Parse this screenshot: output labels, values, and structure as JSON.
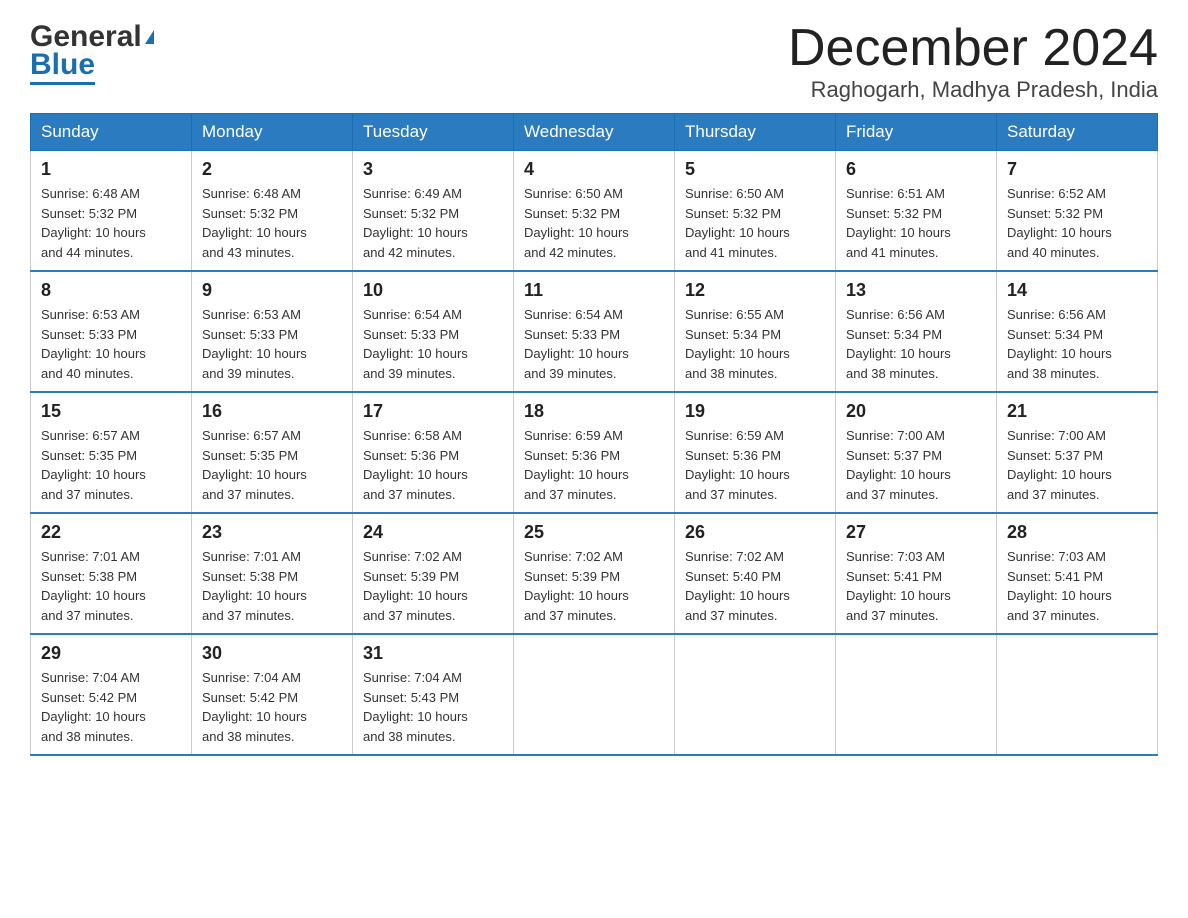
{
  "header": {
    "logo_general": "General",
    "logo_blue": "Blue",
    "month_year": "December 2024",
    "location": "Raghogarh, Madhya Pradesh, India"
  },
  "weekdays": [
    "Sunday",
    "Monday",
    "Tuesday",
    "Wednesday",
    "Thursday",
    "Friday",
    "Saturday"
  ],
  "weeks": [
    [
      {
        "day": "1",
        "sunrise": "6:48 AM",
        "sunset": "5:32 PM",
        "daylight": "10 hours and 44 minutes."
      },
      {
        "day": "2",
        "sunrise": "6:48 AM",
        "sunset": "5:32 PM",
        "daylight": "10 hours and 43 minutes."
      },
      {
        "day": "3",
        "sunrise": "6:49 AM",
        "sunset": "5:32 PM",
        "daylight": "10 hours and 42 minutes."
      },
      {
        "day": "4",
        "sunrise": "6:50 AM",
        "sunset": "5:32 PM",
        "daylight": "10 hours and 42 minutes."
      },
      {
        "day": "5",
        "sunrise": "6:50 AM",
        "sunset": "5:32 PM",
        "daylight": "10 hours and 41 minutes."
      },
      {
        "day": "6",
        "sunrise": "6:51 AM",
        "sunset": "5:32 PM",
        "daylight": "10 hours and 41 minutes."
      },
      {
        "day": "7",
        "sunrise": "6:52 AM",
        "sunset": "5:32 PM",
        "daylight": "10 hours and 40 minutes."
      }
    ],
    [
      {
        "day": "8",
        "sunrise": "6:53 AM",
        "sunset": "5:33 PM",
        "daylight": "10 hours and 40 minutes."
      },
      {
        "day": "9",
        "sunrise": "6:53 AM",
        "sunset": "5:33 PM",
        "daylight": "10 hours and 39 minutes."
      },
      {
        "day": "10",
        "sunrise": "6:54 AM",
        "sunset": "5:33 PM",
        "daylight": "10 hours and 39 minutes."
      },
      {
        "day": "11",
        "sunrise": "6:54 AM",
        "sunset": "5:33 PM",
        "daylight": "10 hours and 39 minutes."
      },
      {
        "day": "12",
        "sunrise": "6:55 AM",
        "sunset": "5:34 PM",
        "daylight": "10 hours and 38 minutes."
      },
      {
        "day": "13",
        "sunrise": "6:56 AM",
        "sunset": "5:34 PM",
        "daylight": "10 hours and 38 minutes."
      },
      {
        "day": "14",
        "sunrise": "6:56 AM",
        "sunset": "5:34 PM",
        "daylight": "10 hours and 38 minutes."
      }
    ],
    [
      {
        "day": "15",
        "sunrise": "6:57 AM",
        "sunset": "5:35 PM",
        "daylight": "10 hours and 37 minutes."
      },
      {
        "day": "16",
        "sunrise": "6:57 AM",
        "sunset": "5:35 PM",
        "daylight": "10 hours and 37 minutes."
      },
      {
        "day": "17",
        "sunrise": "6:58 AM",
        "sunset": "5:36 PM",
        "daylight": "10 hours and 37 minutes."
      },
      {
        "day": "18",
        "sunrise": "6:59 AM",
        "sunset": "5:36 PM",
        "daylight": "10 hours and 37 minutes."
      },
      {
        "day": "19",
        "sunrise": "6:59 AM",
        "sunset": "5:36 PM",
        "daylight": "10 hours and 37 minutes."
      },
      {
        "day": "20",
        "sunrise": "7:00 AM",
        "sunset": "5:37 PM",
        "daylight": "10 hours and 37 minutes."
      },
      {
        "day": "21",
        "sunrise": "7:00 AM",
        "sunset": "5:37 PM",
        "daylight": "10 hours and 37 minutes."
      }
    ],
    [
      {
        "day": "22",
        "sunrise": "7:01 AM",
        "sunset": "5:38 PM",
        "daylight": "10 hours and 37 minutes."
      },
      {
        "day": "23",
        "sunrise": "7:01 AM",
        "sunset": "5:38 PM",
        "daylight": "10 hours and 37 minutes."
      },
      {
        "day": "24",
        "sunrise": "7:02 AM",
        "sunset": "5:39 PM",
        "daylight": "10 hours and 37 minutes."
      },
      {
        "day": "25",
        "sunrise": "7:02 AM",
        "sunset": "5:39 PM",
        "daylight": "10 hours and 37 minutes."
      },
      {
        "day": "26",
        "sunrise": "7:02 AM",
        "sunset": "5:40 PM",
        "daylight": "10 hours and 37 minutes."
      },
      {
        "day": "27",
        "sunrise": "7:03 AM",
        "sunset": "5:41 PM",
        "daylight": "10 hours and 37 minutes."
      },
      {
        "day": "28",
        "sunrise": "7:03 AM",
        "sunset": "5:41 PM",
        "daylight": "10 hours and 37 minutes."
      }
    ],
    [
      {
        "day": "29",
        "sunrise": "7:04 AM",
        "sunset": "5:42 PM",
        "daylight": "10 hours and 38 minutes."
      },
      {
        "day": "30",
        "sunrise": "7:04 AM",
        "sunset": "5:42 PM",
        "daylight": "10 hours and 38 minutes."
      },
      {
        "day": "31",
        "sunrise": "7:04 AM",
        "sunset": "5:43 PM",
        "daylight": "10 hours and 38 minutes."
      },
      null,
      null,
      null,
      null
    ]
  ],
  "labels": {
    "sunrise": "Sunrise:",
    "sunset": "Sunset:",
    "daylight": "Daylight:"
  }
}
